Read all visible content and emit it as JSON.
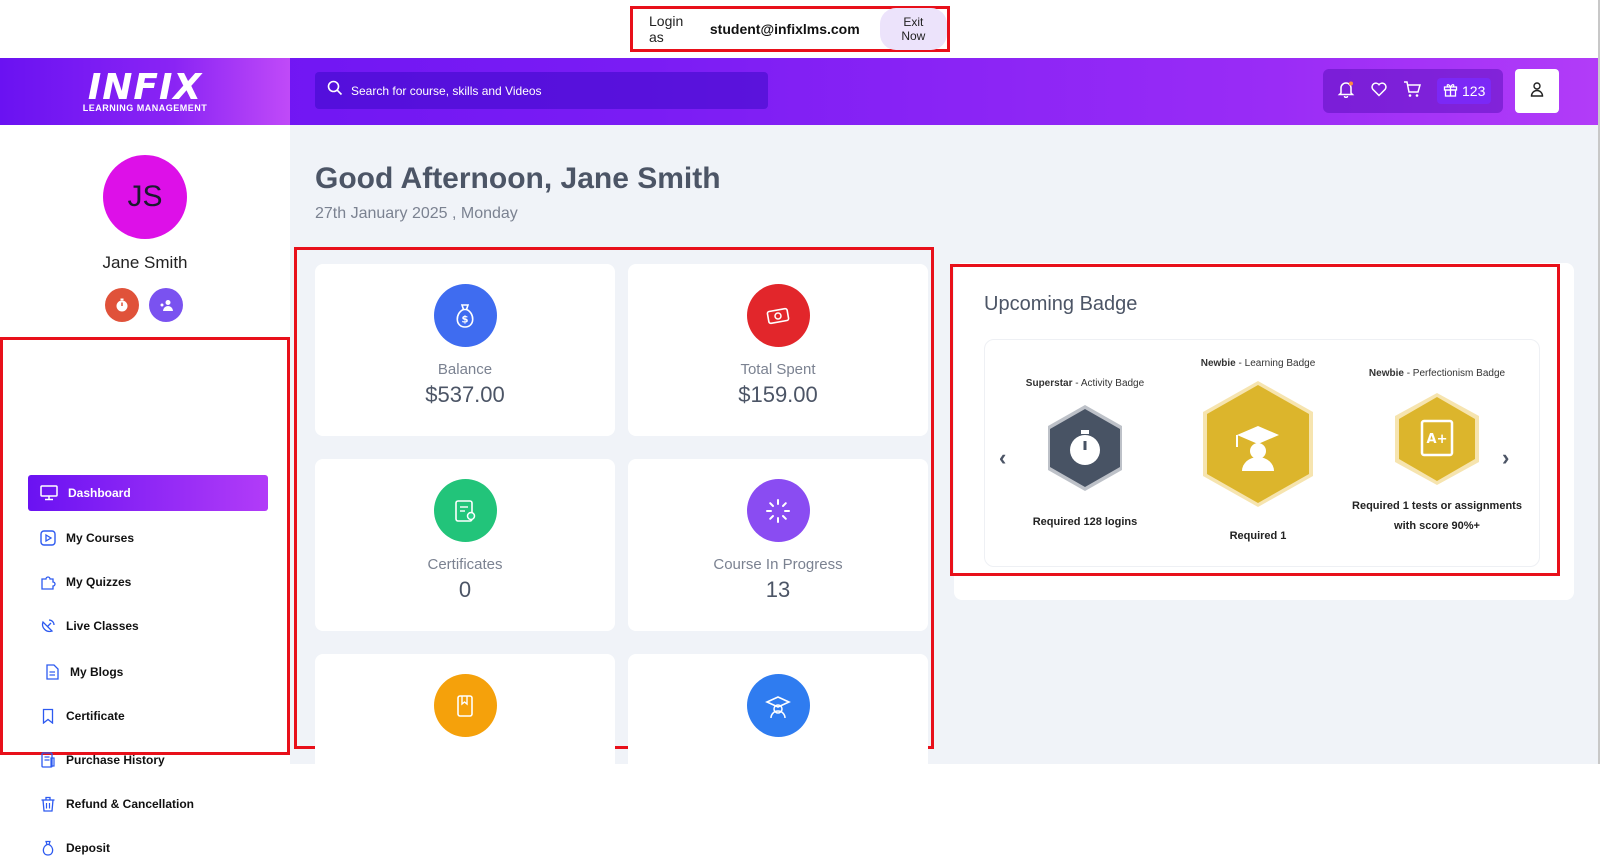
{
  "session": {
    "login_label": "Login as",
    "email": "student@infixlms.com",
    "exit_label": "Exit Now"
  },
  "brand": {
    "name": "INFIX",
    "tagline": "LEARNING MANAGEMENT"
  },
  "search": {
    "placeholder": "Search for course, skills and Videos"
  },
  "header": {
    "gift_count": "123"
  },
  "profile": {
    "initials": "JS",
    "name": "Jane Smith"
  },
  "sidebar": {
    "items": [
      {
        "label": "Dashboard",
        "icon": "monitor-icon"
      },
      {
        "label": "My Courses",
        "icon": "play-icon"
      },
      {
        "label": "My Quizzes",
        "icon": "puzzle-icon"
      },
      {
        "label": "Live Classes",
        "icon": "satellite-icon"
      },
      {
        "label": "My Blogs",
        "icon": "document-icon"
      },
      {
        "label": "Certificate",
        "icon": "bookmark-icon"
      },
      {
        "label": "Purchase History",
        "icon": "receipt-icon"
      },
      {
        "label": "Refund & Cancellation",
        "icon": "trash-icon"
      },
      {
        "label": "Deposit",
        "icon": "moneybag-icon"
      }
    ]
  },
  "main": {
    "greeting": "Good Afternoon, Jane Smith",
    "date": "27th January 2025 , Monday",
    "stats": [
      {
        "label": "Balance",
        "value": "$537.00",
        "color": "#3f6cf0"
      },
      {
        "label": "Total Spent",
        "value": "$159.00",
        "color": "#e2262b"
      },
      {
        "label": "Certificates",
        "value": "0",
        "color": "#22c47a"
      },
      {
        "label": "Course In Progress",
        "value": "13",
        "color": "#8a4cf2"
      },
      {
        "label": "",
        "value": "",
        "color": "#f5a10b"
      },
      {
        "label": "",
        "value": "",
        "color": "#2f7cf0"
      }
    ]
  },
  "badges": {
    "title": "Upcoming Badge",
    "items": [
      {
        "name": "Superstar",
        "type": " - Activity Badge",
        "requirement": "Required 128 logins"
      },
      {
        "name": "Newbie",
        "type": " - Learning Badge",
        "requirement": "Required 1"
      },
      {
        "name": "Newbie",
        "type": " - Perfectionism Badge",
        "requirement": "Required 1 tests or assignments",
        "requirement2": "with score 90%+"
      }
    ]
  }
}
